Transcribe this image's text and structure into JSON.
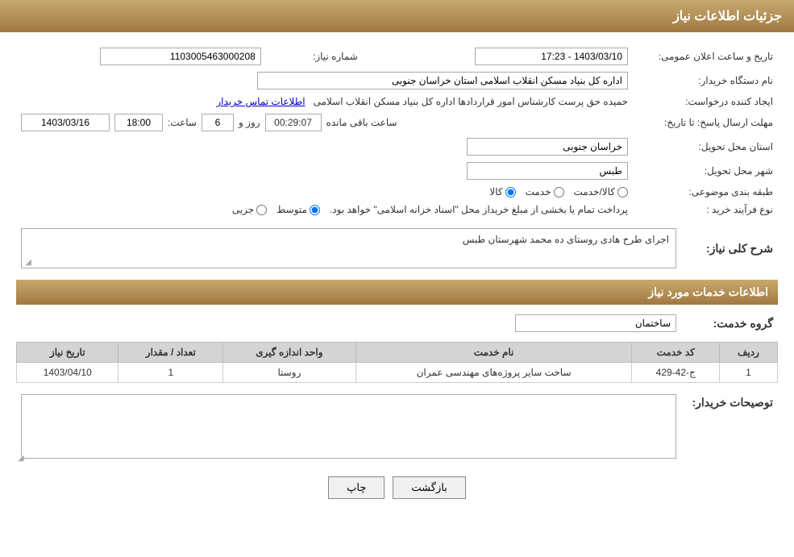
{
  "page": {
    "header_title": "جزئیات اطلاعات نیاز"
  },
  "fields": {
    "shomara_niaz_label": "شماره نیاز:",
    "shomara_niaz_value": "1103005463000208",
    "tarikh_label": "تاریخ و ساعت اعلان عمومی:",
    "tarikh_value": "1403/03/10 - 17:23",
    "nam_dastgah_label": "نام دستگاه خریدار:",
    "nam_dastgah_value": "اداره کل بنیاد مسکن انقلاب اسلامی استان خراسان جنوبی",
    "ijad_label": "ایجاد کننده درخواست:",
    "ijad_value": "حمیده حق پرست کارشناس امور قراردادها اداره کل بنیاد مسکن انقلاب اسلامی",
    "ijad_link": "اطلاعات تماس خریدار",
    "mohlat_label": "مهلت ارسال پاسخ: تا تاریخ:",
    "mohlat_date": "1403/03/16",
    "mohlat_saat_label": "ساعت:",
    "mohlat_saat": "18:00",
    "mohlat_rooz_label": "روز و",
    "mohlat_rooz": "6",
    "saat_mande_label": "ساعت باقی مانده",
    "saat_mande": "00:29:07",
    "ostan_label": "استان محل تحویل:",
    "ostan_value": "خراسان جنوبی",
    "shahr_label": "شهر محل تحویل:",
    "shahr_value": "طبس",
    "tabaqe_label": "طبقه بندی موضوعی:",
    "tabaqe_options": [
      "کالا",
      "خدمت",
      "کالا/خدمت"
    ],
    "tabaqe_selected": "کالا",
    "nooe_label": "نوع فرآیند خرید :",
    "nooe_options": [
      "جزیی",
      "متوسط"
    ],
    "nooe_selected": "متوسط",
    "nooe_note": "پرداخت تمام یا بخشی از مبلغ خریداز محل \"اسناد خزانه اسلامی\" خواهد بود.",
    "sharh_label": "شرح کلی نیاز:",
    "sharh_value": "اجرای طرح هادی روستای ده محمد شهرستان طبس",
    "khadamat_section_title": "اطلاعات خدمات مورد نیاز",
    "grooh_label": "گروه خدمت:",
    "grooh_value": "ساختمان",
    "table_headers": [
      "ردیف",
      "کد خدمت",
      "نام خدمت",
      "واحد اندازه گیری",
      "تعداد / مقدار",
      "تاریخ نیاز"
    ],
    "table_rows": [
      {
        "radif": "1",
        "code": "ج-42-429",
        "name": "ساخت سایر پروژه‌های مهندسی عمران",
        "unit": "روستا",
        "count": "1",
        "date": "1403/04/10"
      }
    ],
    "tosif_label": "توصیحات خریدار:",
    "back_btn": "بازگشت",
    "print_btn": "چاپ"
  }
}
